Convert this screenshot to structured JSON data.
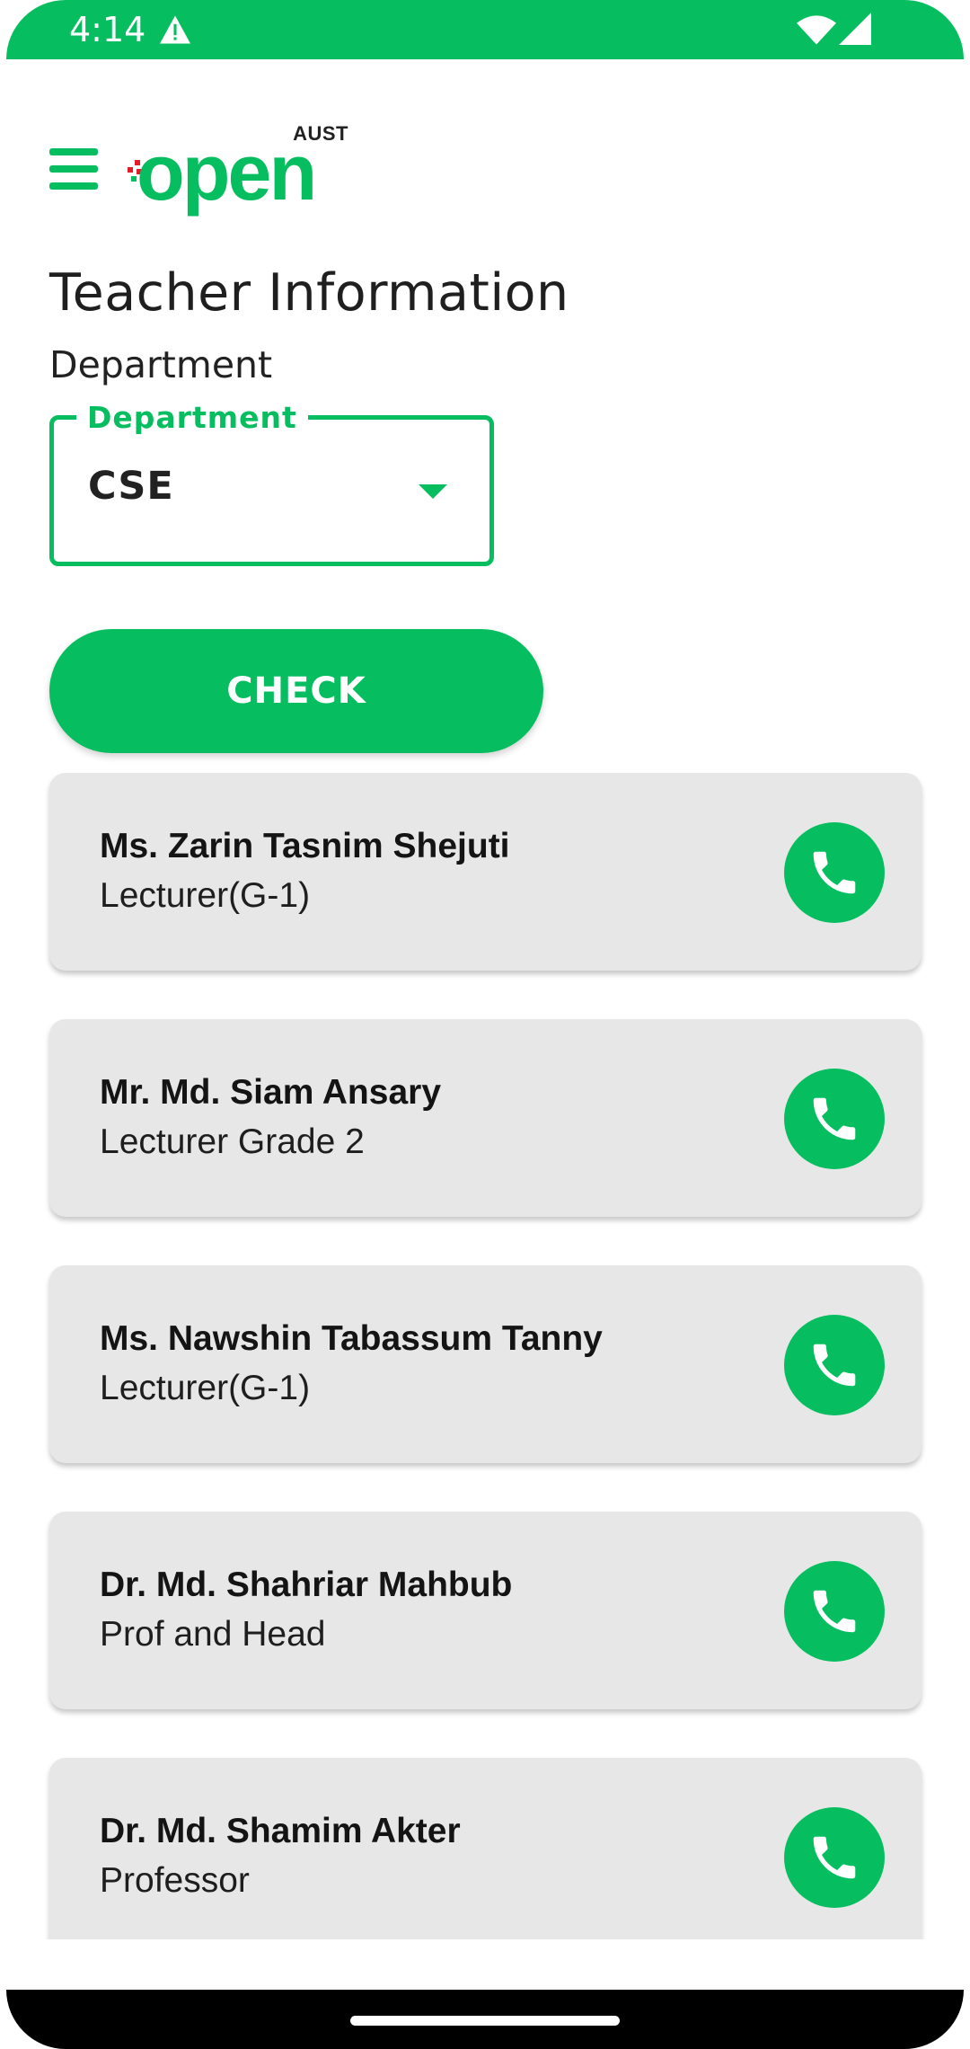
{
  "status_bar": {
    "time": "4:14",
    "accent_color": "#06be5f",
    "icons": [
      "alert-icon",
      "wifi-icon",
      "cell-signal-icon"
    ]
  },
  "header": {
    "logo_small_text": "AUST",
    "logo_text": "open",
    "menu_icon": "hamburger-menu-icon"
  },
  "page": {
    "title": "Teacher Information",
    "department_label": "Department"
  },
  "department_select": {
    "label": "Department",
    "value": "CSE"
  },
  "check_button": {
    "label": "CHECK"
  },
  "teachers": [
    {
      "name": "Ms. Zarin Tasnim Shejuti",
      "title": "Lecturer(G-1)"
    },
    {
      "name": "Mr. Md. Siam Ansary",
      "title": "Lecturer Grade 2"
    },
    {
      "name": "Ms. Nawshin Tabassum Tanny",
      "title": "Lecturer(G-1)"
    },
    {
      "name": "Dr. Md. Shahriar Mahbub",
      "title": "Prof and Head"
    },
    {
      "name": "Dr. Md. Shamim Akter",
      "title": "Professor"
    }
  ],
  "call_icon": "phone-icon"
}
